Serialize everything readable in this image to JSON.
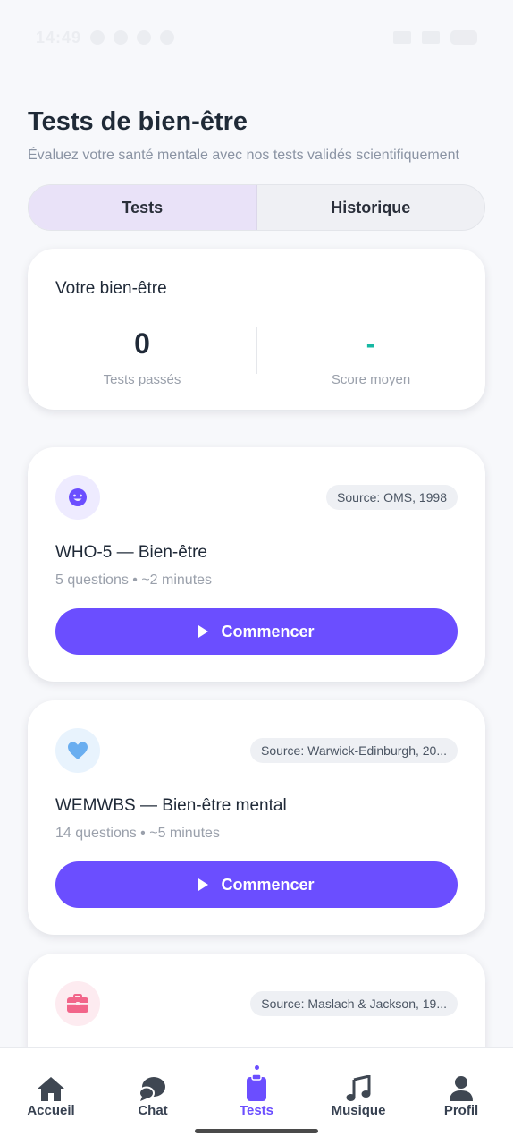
{
  "status_bar": {
    "time": "14:49"
  },
  "header": {
    "title": "Tests de bien-être",
    "subtitle": "Évaluez votre santé mentale avec nos tests validés scientifiquement"
  },
  "tabs": [
    {
      "label": "Tests",
      "active": true
    },
    {
      "label": "Historique",
      "active": false
    }
  ],
  "wellbeing": {
    "title": "Votre bien-être",
    "tests_passed_value": "0",
    "tests_passed_label": "Tests passés",
    "average_score_value": "-",
    "average_score_label": "Score moyen"
  },
  "tests": [
    {
      "icon": "smiley-icon",
      "icon_color": "#6b4eff",
      "icon_bg": "#eeebff",
      "source": "Source: OMS, 1998",
      "title": "WHO-5 — Bien-être",
      "meta": "5 questions • ~2 minutes",
      "button": "Commencer"
    },
    {
      "icon": "heart-icon",
      "icon_color": "#6aaef0",
      "icon_bg": "#e8f3fd",
      "source": "Source: Warwick-Edinburgh, 20...",
      "title": "WEMWBS — Bien-être mental",
      "meta": "14 questions • ~5 minutes",
      "button": "Commencer"
    },
    {
      "icon": "briefcase-icon",
      "icon_color": "#f2658a",
      "icon_bg": "#fdebf0",
      "source": "Source: Maslach & Jackson, 19..."
    }
  ],
  "bottom_nav": [
    {
      "icon": "home-icon",
      "label": "Accueil",
      "active": false
    },
    {
      "icon": "chat-icon",
      "label": "Chat",
      "active": false
    },
    {
      "icon": "clipboard-icon",
      "label": "Tests",
      "active": true
    },
    {
      "icon": "music-icon",
      "label": "Musique",
      "active": false
    },
    {
      "icon": "profile-icon",
      "label": "Profil",
      "active": false
    }
  ],
  "colors": {
    "accent": "#6b4eff",
    "teal": "#16b8a3",
    "background": "#f7f8fb"
  }
}
